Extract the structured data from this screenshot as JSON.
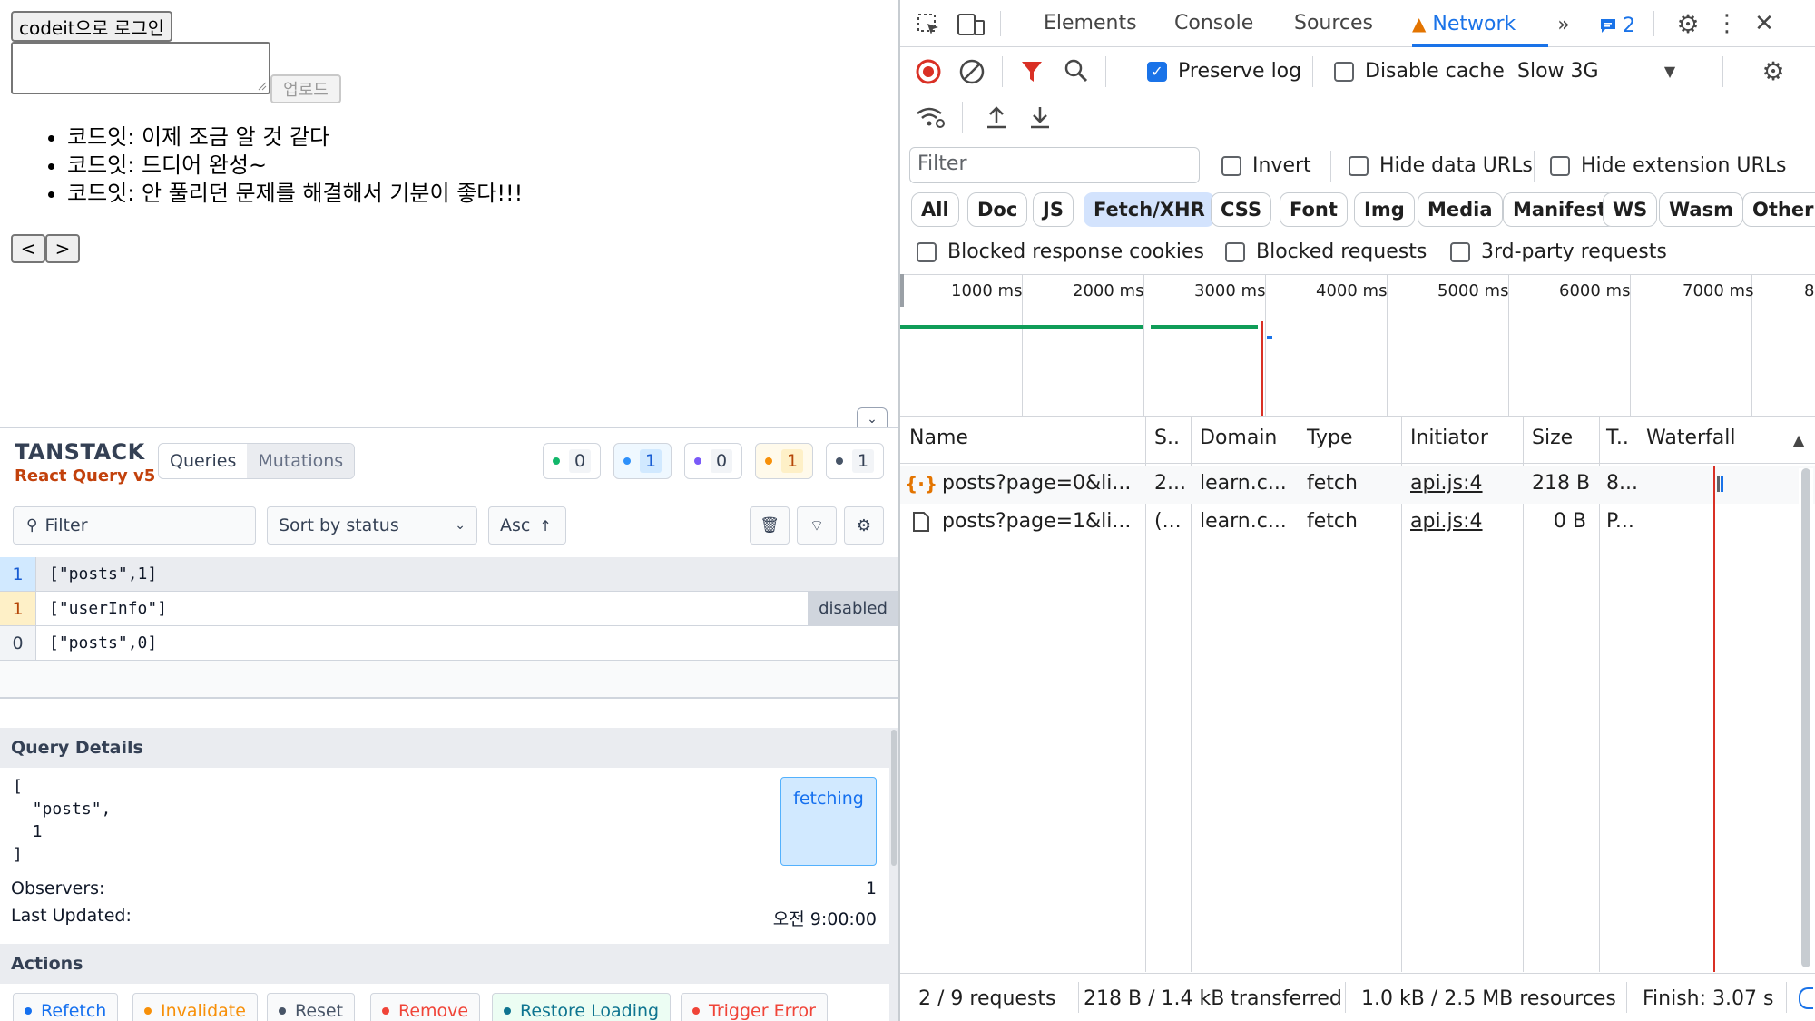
{
  "app": {
    "login_button": "codeit으로 로그인",
    "upload_button": "업로드",
    "posts": [
      "코드잇: 이제 조금 알 것 같다",
      "코드잇:  드디어 완성~",
      "코드잇: 안 풀리던 문제를 해결해서 기분이 좋다!!!"
    ],
    "prev_button": "<",
    "next_button": ">"
  },
  "react_query": {
    "logo_line1": "TANSTACK",
    "logo_line2": "React Query v5",
    "tabs": [
      "Queries",
      "Mutations"
    ],
    "status_counts": [
      {
        "color": "#12b76a",
        "count": "0"
      },
      {
        "color": "#2e90fa",
        "count": "1"
      },
      {
        "color": "#7a5af8",
        "count": "0"
      },
      {
        "color": "#f79009",
        "count": "1"
      },
      {
        "color": "#475467",
        "count": "1"
      }
    ],
    "filter_placeholder": "Filter",
    "sort_label": "Sort by status",
    "order_label": "Asc",
    "queries": [
      {
        "observers": "1",
        "key": "[\"posts\",1]",
        "tag": "",
        "color": "#2e90fa"
      },
      {
        "observers": "1",
        "key": "[\"userInfo\"]",
        "tag": "disabled",
        "color": "#f79009"
      },
      {
        "observers": "0",
        "key": "[\"posts\",0]",
        "tag": "",
        "color": "#475467"
      }
    ],
    "details": {
      "title": "Query Details",
      "key_lines": [
        "[",
        "  \"posts\",",
        "  1",
        "]"
      ],
      "status": "fetching",
      "observers_label": "Observers:",
      "observers_value": "1",
      "updated_label": "Last Updated:",
      "updated_value": "오전 9:00:00"
    },
    "actions_title": "Actions",
    "actions": [
      {
        "label": "Refetch",
        "color": "#1570ef"
      },
      {
        "label": "Invalidate",
        "color": "#f79009"
      },
      {
        "label": "Reset",
        "color": "#475467"
      },
      {
        "label": "Remove",
        "color": "#f04438"
      },
      {
        "label": "Restore Loading",
        "color": "#0e7490"
      },
      {
        "label": "Trigger Error",
        "color": "#f04438"
      }
    ]
  },
  "devtools": {
    "tabs": [
      "Elements",
      "Console",
      "Sources",
      "Network"
    ],
    "active_tab": "Network",
    "issues_count": "2",
    "preserve_log": "Preserve log",
    "disable_cache": "Disable cache",
    "throttle": "Slow 3G",
    "filter_placeholder": "Filter",
    "invert": "Invert",
    "hide_data_urls": "Hide data URLs",
    "hide_extension_urls": "Hide extension URLs",
    "type_filters": [
      "All",
      "Doc",
      "JS",
      "Fetch/XHR",
      "CSS",
      "Font",
      "Img",
      "Media",
      "Manifest",
      "WS",
      "Wasm",
      "Other"
    ],
    "active_filter": "Fetch/XHR",
    "blocked_cookies": "Blocked response cookies",
    "blocked_requests": "Blocked requests",
    "third_party": "3rd-party requests",
    "timeline_ticks": [
      "1000 ms",
      "2000 ms",
      "3000 ms",
      "4000 ms",
      "5000 ms",
      "6000 ms",
      "7000 ms",
      "8"
    ],
    "columns": [
      "Name",
      "S..",
      "Domain",
      "Type",
      "Initiator",
      "Size",
      "T..",
      "Waterfall"
    ],
    "requests": [
      {
        "name": "posts?page=0&li...",
        "status": "2...",
        "domain": "learn.c...",
        "type": "fetch",
        "initiator": "api.js:4",
        "size": "218 B",
        "time": "8..."
      },
      {
        "name": "posts?page=1&li...",
        "status": "(...",
        "domain": "learn.c...",
        "type": "fetch",
        "initiator": "api.js:4",
        "size": "0 B",
        "time": "P..."
      }
    ],
    "status_bar": {
      "requests": "2 / 9 requests",
      "transferred": "218 B / 1.4 kB transferred",
      "resources": "1.0 kB / 2.5 MB resources",
      "finish": "Finish: 3.07 s"
    },
    "accent": "#1a73e8",
    "warning_color": "#e37400"
  }
}
